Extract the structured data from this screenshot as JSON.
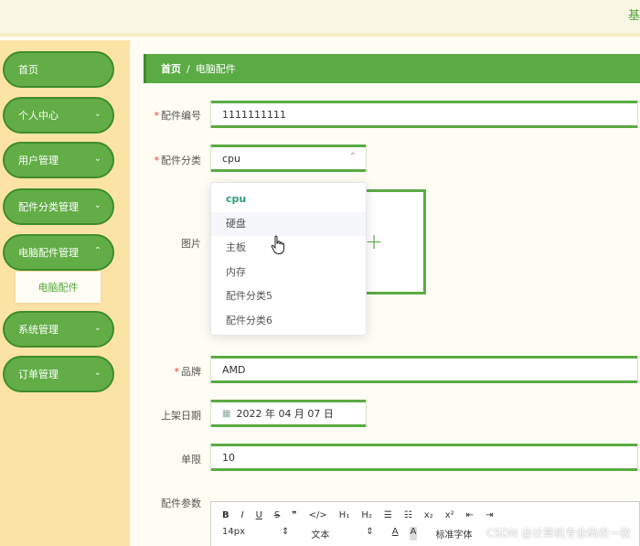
{
  "topbar": {
    "right_text": "基"
  },
  "sidebar": {
    "items": [
      {
        "label": "首页",
        "chevron": false
      },
      {
        "label": "个人中心",
        "chevron": true
      },
      {
        "label": "用户管理",
        "chevron": true
      },
      {
        "label": "配件分类管理",
        "chevron": true
      },
      {
        "label": "电脑配件管理",
        "chevron": true,
        "expanded": true
      },
      {
        "label": "系统管理",
        "chevron": true
      },
      {
        "label": "订单管理",
        "chevron": true
      }
    ],
    "submenu_item": "电脑配件",
    "chevron_down": "⌄",
    "chevron_up": "⌃"
  },
  "breadcrumb": {
    "home": "首页",
    "separator": "/",
    "current": "电脑配件"
  },
  "form": {
    "part_number": {
      "required": "*",
      "label": "配件编号",
      "value": "1111111111"
    },
    "category": {
      "required": "*",
      "label": "配件分类",
      "value": "cpu",
      "arrow": "⌃"
    },
    "image": {
      "label": "图片",
      "plus": "+"
    },
    "brand": {
      "required": "*",
      "label": "品牌",
      "value": "AMD"
    },
    "listed_date": {
      "label": "上架日期",
      "value": "2022 年 04 月 07 日",
      "icon": "▦"
    },
    "limit": {
      "label": "单限",
      "value": "10"
    },
    "params": {
      "label": "配件参数"
    }
  },
  "dropdown": {
    "options": [
      "cpu",
      "硬盘",
      "主板",
      "内存",
      "配件分类5",
      "配件分类6"
    ],
    "selected": "cpu",
    "hovered": "硬盘"
  },
  "editor": {
    "row1": [
      "B",
      "I",
      "U",
      "S",
      "❞",
      "</>",
      "H₁",
      "H₂",
      "☰",
      "☷",
      "x₂",
      "x²",
      "⇤",
      "⇥"
    ],
    "row2": {
      "size": "14px",
      "size_arrow": "⇕",
      "format": "文本",
      "format_arrow": "⇕",
      "font_color": "A",
      "bg_color": "A",
      "font": "标准字体"
    }
  },
  "watermark": "CSDN @计算机专业码农一枚"
}
